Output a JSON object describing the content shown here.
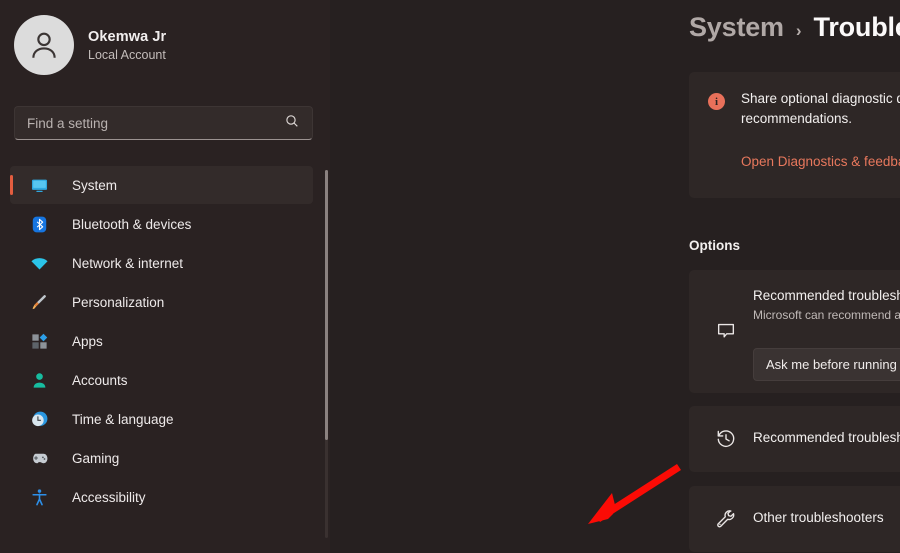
{
  "sidebar": {
    "profile": {
      "name": "Okemwa Jr",
      "account_type": "Local Account",
      "avatar_icon": "person-avatar-icon"
    },
    "search": {
      "placeholder": "Find a setting",
      "value": "",
      "icon": "search-icon"
    },
    "items": [
      {
        "label": "System",
        "icon": "monitor-icon",
        "selected": true
      },
      {
        "label": "Bluetooth & devices",
        "icon": "bluetooth-icon",
        "selected": false
      },
      {
        "label": "Network & internet",
        "icon": "wifi-icon",
        "selected": false
      },
      {
        "label": "Personalization",
        "icon": "brush-icon",
        "selected": false
      },
      {
        "label": "Apps",
        "icon": "apps-icon",
        "selected": false
      },
      {
        "label": "Accounts",
        "icon": "account-icon",
        "selected": false
      },
      {
        "label": "Time & language",
        "icon": "clock-icon",
        "selected": false
      },
      {
        "label": "Gaming",
        "icon": "gamepad-icon",
        "selected": false
      },
      {
        "label": "Accessibility",
        "icon": "accessibility-icon",
        "selected": false
      }
    ]
  },
  "header": {
    "breadcrumb_parent": "System",
    "breadcrumb_separator": "›",
    "breadcrumb_current": "Troubleshoot"
  },
  "banner": {
    "icon": "info-icon",
    "icon_glyph": "i",
    "message": "Share optional diagnostic data to get additional troubleshooting recommendations.",
    "link_label": "Open Diagnostics & feedback"
  },
  "options": {
    "section_title": "Options",
    "preferences": {
      "icon": "speech-bubble-icon",
      "title": "Recommended troubleshooter preferences",
      "subtitle": "Microsoft can recommend and run troubleshooters to fix issues",
      "dropdown_value": "Ask me before running",
      "dropdown_chevron": "chevron-down-icon"
    },
    "rows": [
      {
        "label": "Recommended troubleshooter history",
        "icon": "history-icon",
        "chevron": "chevron-right-icon"
      },
      {
        "label": "Other troubleshooters",
        "icon": "wrench-icon",
        "chevron": "chevron-right-icon"
      }
    ]
  },
  "annotation": {
    "type": "arrow",
    "color": "#fb0b05",
    "points_to": "Other troubleshooters"
  },
  "colors": {
    "accent": "#e35d3f",
    "link": "#e8785d",
    "info_badge": "#e8705a",
    "page_bg": "#262020",
    "sidebar_bg": "#2a2222",
    "card_bg": "#2e2726",
    "annotation_red": "#fb0b05"
  }
}
